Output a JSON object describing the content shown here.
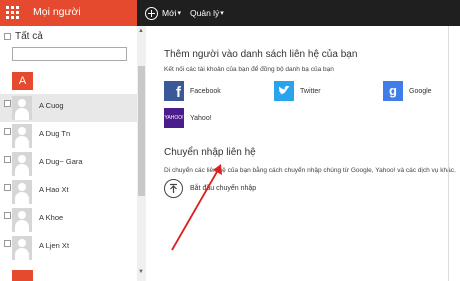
{
  "header": {
    "app_title": "Mọi người",
    "new_label": "Mới",
    "manage_label": "Quản lý",
    "brand_color": "#e64a2e"
  },
  "sidebar": {
    "select_all_label": "Tất cả",
    "letter": "A",
    "contacts": [
      {
        "name": "A Cuog",
        "selected": true
      },
      {
        "name": "A Dug Tn",
        "selected": false
      },
      {
        "name": "A Dug~ Gara",
        "selected": false
      },
      {
        "name": "A Hao Xt",
        "selected": false
      },
      {
        "name": "A Khoe",
        "selected": false
      },
      {
        "name": "A Ljen Xt",
        "selected": false
      }
    ]
  },
  "main": {
    "add_title": "Thêm người vào danh sách liên hệ của bạn",
    "add_subtitle": "Kết nối các tài khoản của bạn để đồng bộ danh bạ của bạn",
    "services": [
      {
        "name": "Facebook",
        "icon": "facebook-icon",
        "color": "#3b5998"
      },
      {
        "name": "Twitter",
        "icon": "twitter-icon",
        "color": "#2aa3ef"
      },
      {
        "name": "Google",
        "icon": "google-icon",
        "color": "#3f7ee8"
      },
      {
        "name": "Yahoo!",
        "icon": "yahoo-icon",
        "color": "#4a1c8c"
      }
    ],
    "yahoo_logo_text": "YAHOO!",
    "import_title": "Chuyển nhập liên hệ",
    "import_desc": "Di chuyển các liên hệ của bạn bằng cách chuyển nhập chúng từ Google, Yahoo! và các dịch vụ khác.",
    "import_action": "Bắt đầu chuyển nhập"
  }
}
